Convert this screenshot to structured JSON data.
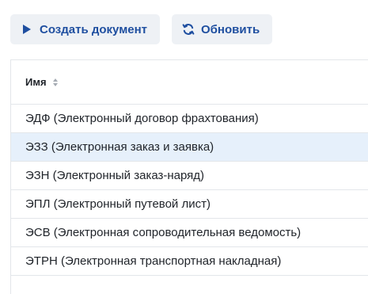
{
  "toolbar": {
    "create_label": "Создать документ",
    "refresh_label": "Обновить"
  },
  "table": {
    "column_name": "Имя",
    "rows": [
      {
        "name": "ЭДФ (Электронный договор фрахтования)",
        "selected": false
      },
      {
        "name": "ЭЗЗ (Электронная заказ и заявка)",
        "selected": true
      },
      {
        "name": "ЭЗН (Электронный заказ-наряд)",
        "selected": false
      },
      {
        "name": "ЭПЛ (Электронный путевой лист)",
        "selected": false
      },
      {
        "name": "ЭСВ (Электронная сопроводительная ведомость)",
        "selected": false
      },
      {
        "name": "ЭТРН (Электронная транспортная накладная)",
        "selected": false
      }
    ]
  },
  "colors": {
    "accent": "#1f4fa0",
    "button_bg": "#eef1f5",
    "selected_row_bg": "#e6f0fb",
    "border": "#e3e6ea"
  },
  "icons": {
    "create": "play-icon",
    "refresh": "refresh-icon",
    "sort": "sort-icon"
  }
}
